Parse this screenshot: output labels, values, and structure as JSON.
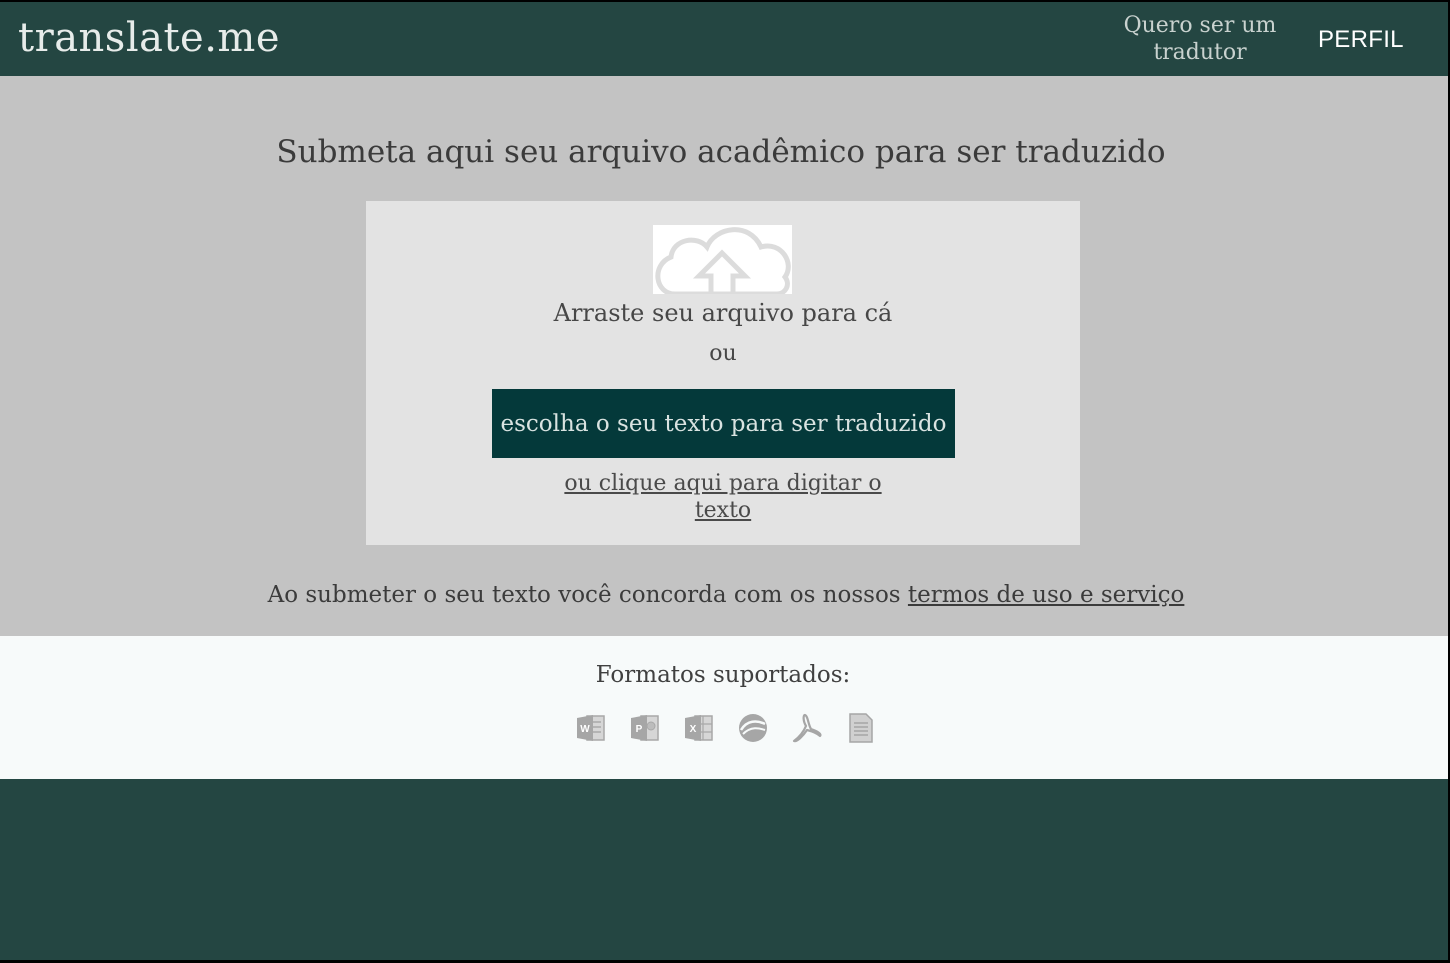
{
  "header": {
    "logo": "translate.me",
    "translator_link": "Quero ser um tradutor",
    "profile_link": "PERFIL"
  },
  "main": {
    "headline": "Submeta aqui seu arquivo acadêmico para ser traduzido",
    "upload": {
      "icon": "cloud-upload-icon",
      "drag_text": "Arraste seu arquivo para cá",
      "or_text": "ou",
      "choose_button": "escolha o seu texto para ser traduzido",
      "type_link": "ou clique aqui para digitar o texto"
    },
    "terms_prefix": "Ao submeter o seu texto você concorda com os nossos ",
    "terms_link": "termos de uso e serviço"
  },
  "formats": {
    "title": "Formatos suportados:",
    "icons": [
      "word-icon",
      "powerpoint-icon",
      "excel-icon",
      "openoffice-icon",
      "pdf-icon",
      "text-file-icon"
    ]
  },
  "colors": {
    "header_bg": "#244642",
    "main_bg": "#c3c3c3",
    "upload_bg": "#e3e3e3",
    "button_bg": "#04393a",
    "formats_bg": "#f7fafa",
    "footer_bg": "#244642"
  }
}
